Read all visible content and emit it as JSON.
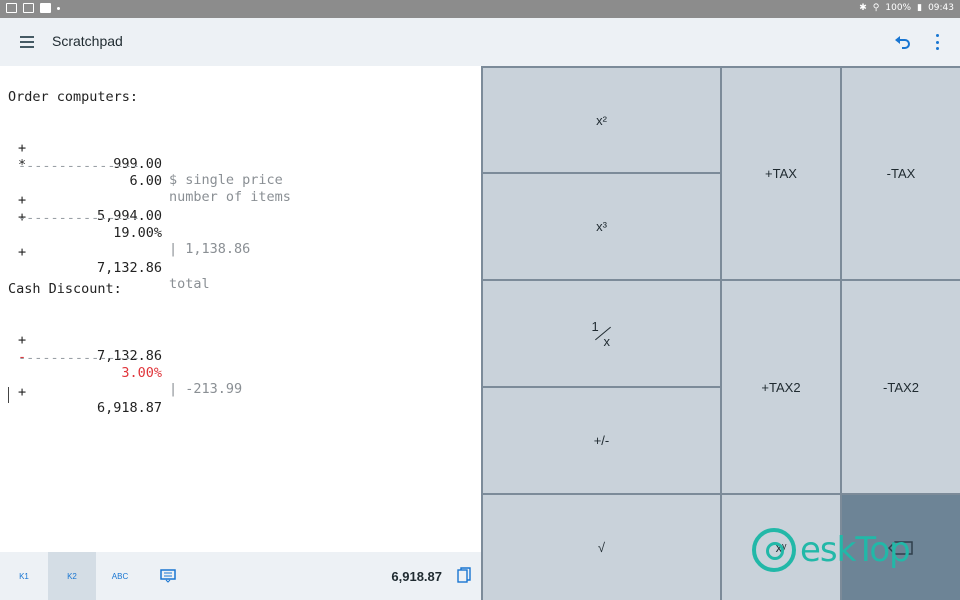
{
  "status_bar": {
    "battery": "100%",
    "time": "09:43"
  },
  "app_bar": {
    "title": "Scratchpad"
  },
  "scratchpad": {
    "heading1": "Order computers:",
    "lines1": [
      {
        "op": "+",
        "num": "999.00",
        "comment": "$ single price"
      },
      {
        "op": "*",
        "num": "6.00",
        "comment": "number of items"
      }
    ],
    "dashes": "---------------",
    "sub1": {
      "op": "+",
      "num": "5,994.00"
    },
    "tax1": {
      "op": "+",
      "num": "19.00%",
      "comment": "| 1,138.86"
    },
    "total1": {
      "op": "+",
      "num": "7,132.86",
      "comment": "total"
    },
    "heading2": "Cash Discount:",
    "line2a": {
      "op": "+",
      "num": "7,132.86"
    },
    "line2b": {
      "op": "-",
      "num": "3.00%",
      "comment": "| -213.99"
    },
    "total2": {
      "op": "+",
      "num": "6,918.87"
    }
  },
  "bottom_bar": {
    "tabs": [
      "K1",
      "K2",
      "ABC"
    ],
    "total": "6,918.87"
  },
  "keypad": {
    "square": "x²",
    "cube": "x³",
    "recip_num": "1",
    "recip_den": "x",
    "plus_minus": "+/-",
    "sqrt": "√",
    "plus_tax": "+TAX",
    "minus_tax": "-TAX",
    "plus_tax2": "+TAX2",
    "minus_tax2": "-TAX2",
    "pow_label": "xʸ"
  },
  "watermark": {
    "text": "eskTop"
  },
  "colors": {
    "accent": "#1976d2",
    "key_bg": "#c9d2da",
    "grid": "#7c8b99",
    "negative": "#e0343a"
  }
}
